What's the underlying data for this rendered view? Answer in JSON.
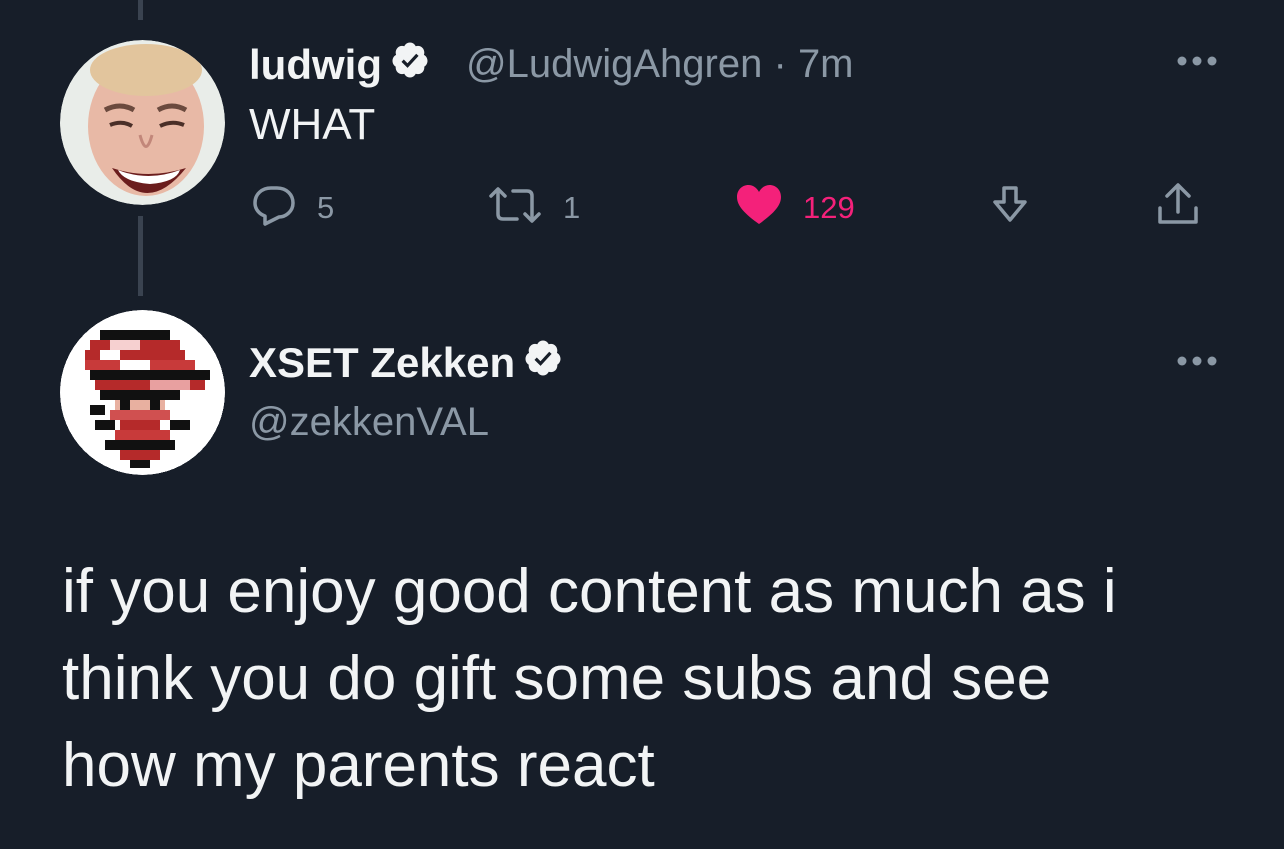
{
  "tweet1": {
    "name": "ludwig",
    "handle": "@LudwigAhgren",
    "separator": "·",
    "time": "7m",
    "text": "WHAT",
    "actions": {
      "reply": {
        "count": "5",
        "icon": "reply-icon"
      },
      "retweet": {
        "count": "1",
        "icon": "retweet-icon"
      },
      "like": {
        "count": "129",
        "icon": "heart-icon",
        "liked": true,
        "color": "#f4217a"
      },
      "bookmark": {
        "icon": "bookmark-icon"
      },
      "share": {
        "icon": "share-icon"
      }
    }
  },
  "tweet2": {
    "name": "XSET Zekken",
    "handle": "@zekkenVAL",
    "body_lines": [
      "if you enjoy good content as much as i",
      "think you do gift some subs and see",
      "how my parents react"
    ]
  },
  "colors": {
    "background": "#171e29",
    "secondary_text": "#8b98a5",
    "like": "#f4217a",
    "thread_line": "#3a4350"
  }
}
